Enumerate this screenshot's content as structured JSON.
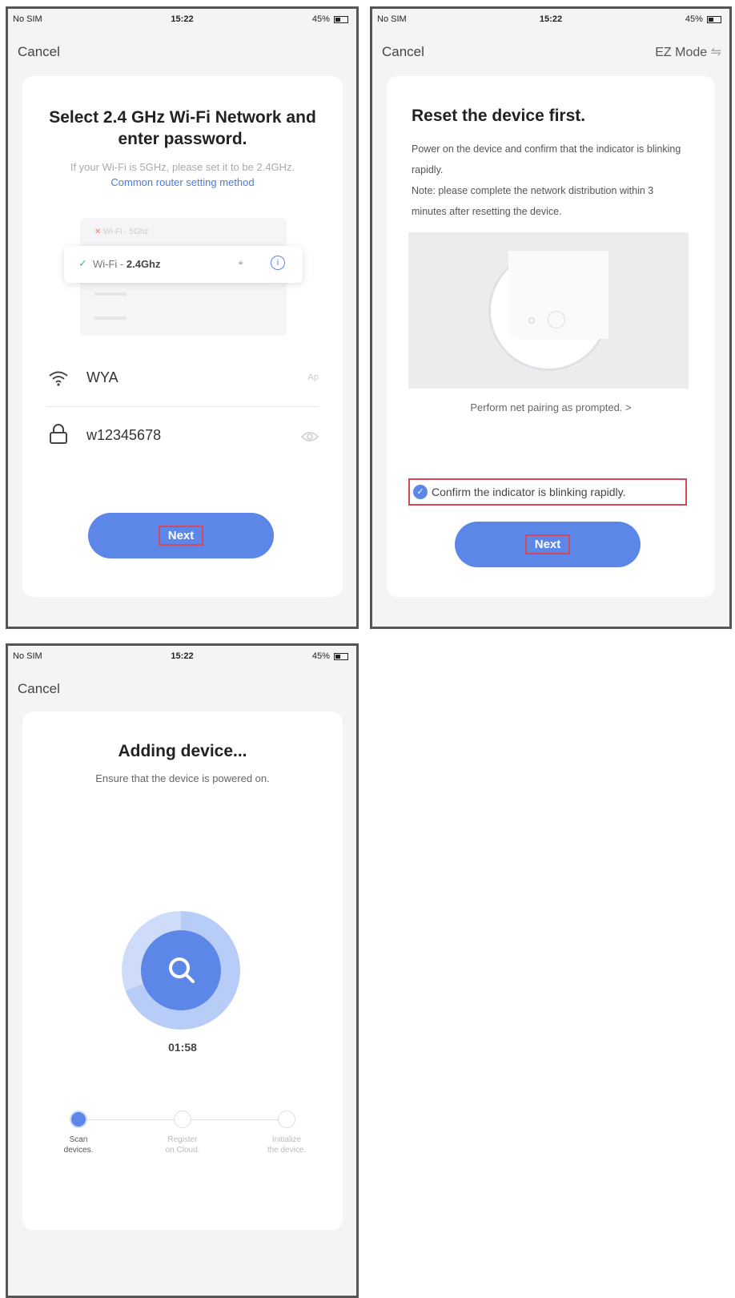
{
  "status_bar": {
    "carrier": "No SIM",
    "time": "15:22",
    "battery": "45%"
  },
  "screen1": {
    "cancel": "Cancel",
    "title": "Select 2.4 GHz Wi-Fi Network and enter password.",
    "desc": "If your Wi-Fi is 5GHz, please set it to be 2.4GHz.",
    "desc_link": "Common router setting method",
    "wifi_5g": "Wi-Fi - 5Ghz",
    "wifi_24_prefix": "Wi-Fi - ",
    "wifi_24_band": "2.4Ghz",
    "ssid": "WYA",
    "ssid_hint": "Ap",
    "password": "w12345678",
    "next": "Next"
  },
  "screen2": {
    "cancel": "Cancel",
    "mode": "EZ Mode",
    "title": "Reset the device first.",
    "desc1": "Power on the device and confirm that the indicator is blinking rapidly.",
    "desc2": "Note: please complete the network distribution within 3 minutes after resetting the device.",
    "link": "Perform net pairing as prompted. >",
    "confirm": "Confirm the indicator is blinking rapidly.",
    "next": "Next"
  },
  "screen3": {
    "cancel": "Cancel",
    "title": "Adding device...",
    "subtitle": "Ensure that the device is powered on.",
    "timer": "01:58",
    "steps": [
      {
        "label1": "Scan",
        "label2": "devices.",
        "active": true
      },
      {
        "label1": "Register",
        "label2": "on Cloud.",
        "active": false
      },
      {
        "label1": "Initialize",
        "label2": "the device.",
        "active": false
      }
    ]
  },
  "colors": {
    "accent": "#5c86e8",
    "highlight_border": "#d34a5a",
    "link": "#4a7be0"
  },
  "icons": [
    "wifi-icon",
    "lock-icon",
    "eye-icon",
    "check-icon",
    "x-icon",
    "info-icon",
    "search-icon",
    "chevron-right-icon",
    "battery-icon"
  ]
}
